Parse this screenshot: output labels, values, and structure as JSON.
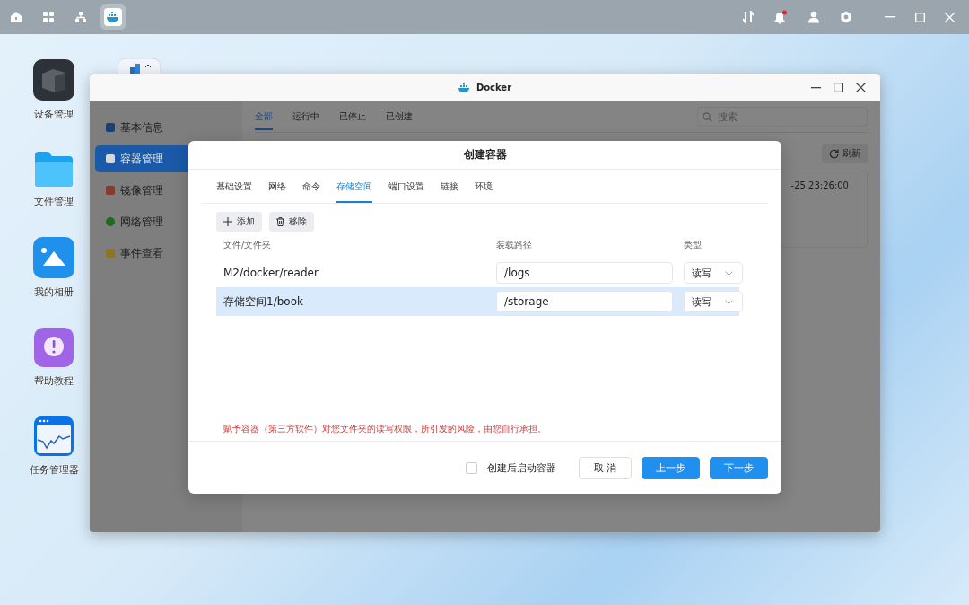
{
  "taskbar": {
    "apps": [
      {
        "kind": "home",
        "selected": false
      },
      {
        "kind": "grid",
        "selected": false
      },
      {
        "kind": "network",
        "selected": false
      },
      {
        "kind": "docker",
        "selected": true
      }
    ],
    "notifications": {
      "unread": true
    }
  },
  "desktop": {
    "icons": [
      {
        "kind": "device",
        "label": "设备管理"
      },
      {
        "kind": "folder",
        "label": "文件管理"
      },
      {
        "kind": "photo",
        "label": "我的相册"
      },
      {
        "kind": "help",
        "label": "帮助教程"
      },
      {
        "kind": "monitor",
        "label": "任务管理器"
      }
    ]
  },
  "docker": {
    "title": "Docker",
    "sidebar": [
      {
        "kind": "info",
        "label": "基本信息",
        "selected": false
      },
      {
        "kind": "container",
        "label": "容器管理",
        "selected": true
      },
      {
        "kind": "image",
        "label": "镜像管理",
        "selected": false
      },
      {
        "kind": "network",
        "label": "网络管理",
        "selected": false
      },
      {
        "kind": "event",
        "label": "事件查看",
        "selected": false
      }
    ],
    "tabs": [
      {
        "label": "全部",
        "selected": true
      },
      {
        "label": "运行中",
        "selected": false
      },
      {
        "label": "已停止",
        "selected": false
      },
      {
        "label": "已创建",
        "selected": false
      }
    ],
    "search": {
      "placeholder": "搜索"
    },
    "refresh": "刷新",
    "row_time": "-25 23:26:00"
  },
  "dialog": {
    "title": "创建容器",
    "tabs": [
      {
        "label": "基础设置",
        "selected": false
      },
      {
        "label": "网络",
        "selected": false
      },
      {
        "label": "命令",
        "selected": false
      },
      {
        "label": "存储空间",
        "selected": true
      },
      {
        "label": "端口设置",
        "selected": false
      },
      {
        "label": "链接",
        "selected": false
      },
      {
        "label": "环境",
        "selected": false
      }
    ],
    "add": "添加",
    "remove": "移除",
    "columns": [
      "文件/文件夹",
      "装载路径",
      "类型"
    ],
    "rows": [
      {
        "folder": "M2/docker/reader",
        "mount": "/logs",
        "type": "读写",
        "selected": false
      },
      {
        "folder": "存储空间1/book",
        "mount": "/storage",
        "type": "读写",
        "selected": true
      }
    ],
    "warning": "赋予容器（第三方软件）对您文件夹的读写权限，所引发的风险，由您自行承担。",
    "autostart": {
      "label": "创建后启动容器",
      "checked": false
    },
    "cancel": "取 消",
    "prev": "上一步",
    "next": "下一步"
  }
}
